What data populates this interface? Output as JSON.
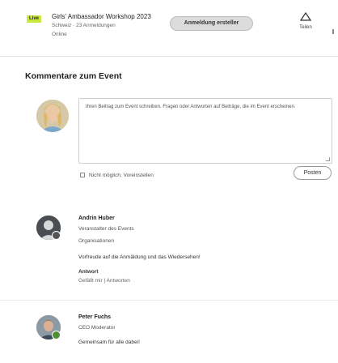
{
  "event": {
    "badge": "Live",
    "title": "Girls' Ambassador Workshop 2023",
    "subtitle": "Schweiz · 23 Anmeldungen",
    "meta": "Online"
  },
  "toolbar": {
    "cta_label": "Anmeldung ersteller",
    "share_label": "Teilen",
    "share_icon": "share-arrow-icon"
  },
  "comments_section": {
    "title": "Kommentare zum Event",
    "compose_text": "Ihren Beitrag zum Event schreiben. Fragen oder Antworten auf Beiträge, die im Event erscheinen.",
    "notify_label": "Nicht möglich, Voreinstellen",
    "post_label": "Posten"
  },
  "comments": [
    {
      "name": "Andrin Huber",
      "lines": [
        "Veranstalter des Events",
        "Organisationen"
      ],
      "body": "Vorfreude auf die Anmäldung und das Wiedersehen!",
      "link_title": "Antwort",
      "actions": [
        "Gefällt mir",
        "Antworten"
      ]
    },
    {
      "name": "Peter Fuchs",
      "lines": [
        "CEO Moderator"
      ],
      "body": "Gemeinsam für alle dabei!"
    }
  ]
}
